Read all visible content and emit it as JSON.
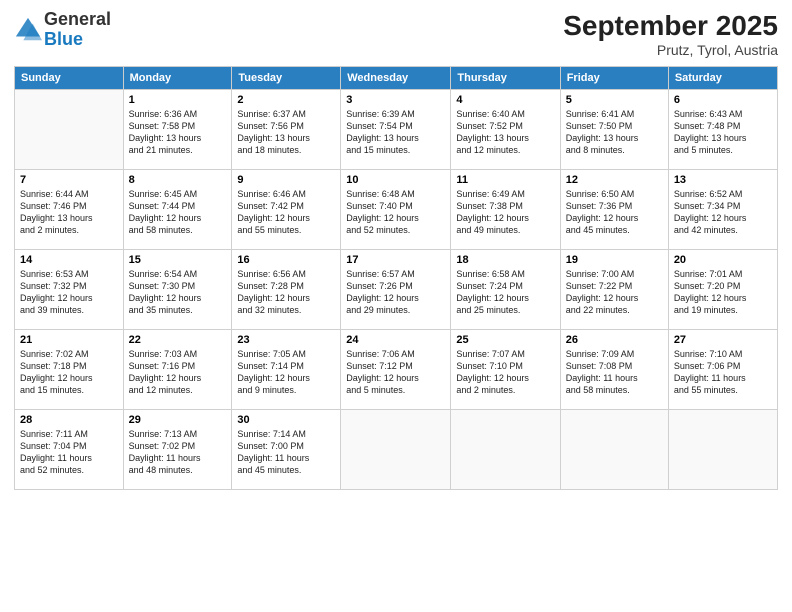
{
  "header": {
    "logo_general": "General",
    "logo_blue": "Blue",
    "month_title": "September 2025",
    "location": "Prutz, Tyrol, Austria"
  },
  "days_of_week": [
    "Sunday",
    "Monday",
    "Tuesday",
    "Wednesday",
    "Thursday",
    "Friday",
    "Saturday"
  ],
  "weeks": [
    [
      {
        "day": "",
        "text": ""
      },
      {
        "day": "1",
        "text": "Sunrise: 6:36 AM\nSunset: 7:58 PM\nDaylight: 13 hours\nand 21 minutes."
      },
      {
        "day": "2",
        "text": "Sunrise: 6:37 AM\nSunset: 7:56 PM\nDaylight: 13 hours\nand 18 minutes."
      },
      {
        "day": "3",
        "text": "Sunrise: 6:39 AM\nSunset: 7:54 PM\nDaylight: 13 hours\nand 15 minutes."
      },
      {
        "day": "4",
        "text": "Sunrise: 6:40 AM\nSunset: 7:52 PM\nDaylight: 13 hours\nand 12 minutes."
      },
      {
        "day": "5",
        "text": "Sunrise: 6:41 AM\nSunset: 7:50 PM\nDaylight: 13 hours\nand 8 minutes."
      },
      {
        "day": "6",
        "text": "Sunrise: 6:43 AM\nSunset: 7:48 PM\nDaylight: 13 hours\nand 5 minutes."
      }
    ],
    [
      {
        "day": "7",
        "text": "Sunrise: 6:44 AM\nSunset: 7:46 PM\nDaylight: 13 hours\nand 2 minutes."
      },
      {
        "day": "8",
        "text": "Sunrise: 6:45 AM\nSunset: 7:44 PM\nDaylight: 12 hours\nand 58 minutes."
      },
      {
        "day": "9",
        "text": "Sunrise: 6:46 AM\nSunset: 7:42 PM\nDaylight: 12 hours\nand 55 minutes."
      },
      {
        "day": "10",
        "text": "Sunrise: 6:48 AM\nSunset: 7:40 PM\nDaylight: 12 hours\nand 52 minutes."
      },
      {
        "day": "11",
        "text": "Sunrise: 6:49 AM\nSunset: 7:38 PM\nDaylight: 12 hours\nand 49 minutes."
      },
      {
        "day": "12",
        "text": "Sunrise: 6:50 AM\nSunset: 7:36 PM\nDaylight: 12 hours\nand 45 minutes."
      },
      {
        "day": "13",
        "text": "Sunrise: 6:52 AM\nSunset: 7:34 PM\nDaylight: 12 hours\nand 42 minutes."
      }
    ],
    [
      {
        "day": "14",
        "text": "Sunrise: 6:53 AM\nSunset: 7:32 PM\nDaylight: 12 hours\nand 39 minutes."
      },
      {
        "day": "15",
        "text": "Sunrise: 6:54 AM\nSunset: 7:30 PM\nDaylight: 12 hours\nand 35 minutes."
      },
      {
        "day": "16",
        "text": "Sunrise: 6:56 AM\nSunset: 7:28 PM\nDaylight: 12 hours\nand 32 minutes."
      },
      {
        "day": "17",
        "text": "Sunrise: 6:57 AM\nSunset: 7:26 PM\nDaylight: 12 hours\nand 29 minutes."
      },
      {
        "day": "18",
        "text": "Sunrise: 6:58 AM\nSunset: 7:24 PM\nDaylight: 12 hours\nand 25 minutes."
      },
      {
        "day": "19",
        "text": "Sunrise: 7:00 AM\nSunset: 7:22 PM\nDaylight: 12 hours\nand 22 minutes."
      },
      {
        "day": "20",
        "text": "Sunrise: 7:01 AM\nSunset: 7:20 PM\nDaylight: 12 hours\nand 19 minutes."
      }
    ],
    [
      {
        "day": "21",
        "text": "Sunrise: 7:02 AM\nSunset: 7:18 PM\nDaylight: 12 hours\nand 15 minutes."
      },
      {
        "day": "22",
        "text": "Sunrise: 7:03 AM\nSunset: 7:16 PM\nDaylight: 12 hours\nand 12 minutes."
      },
      {
        "day": "23",
        "text": "Sunrise: 7:05 AM\nSunset: 7:14 PM\nDaylight: 12 hours\nand 9 minutes."
      },
      {
        "day": "24",
        "text": "Sunrise: 7:06 AM\nSunset: 7:12 PM\nDaylight: 12 hours\nand 5 minutes."
      },
      {
        "day": "25",
        "text": "Sunrise: 7:07 AM\nSunset: 7:10 PM\nDaylight: 12 hours\nand 2 minutes."
      },
      {
        "day": "26",
        "text": "Sunrise: 7:09 AM\nSunset: 7:08 PM\nDaylight: 11 hours\nand 58 minutes."
      },
      {
        "day": "27",
        "text": "Sunrise: 7:10 AM\nSunset: 7:06 PM\nDaylight: 11 hours\nand 55 minutes."
      }
    ],
    [
      {
        "day": "28",
        "text": "Sunrise: 7:11 AM\nSunset: 7:04 PM\nDaylight: 11 hours\nand 52 minutes."
      },
      {
        "day": "29",
        "text": "Sunrise: 7:13 AM\nSunset: 7:02 PM\nDaylight: 11 hours\nand 48 minutes."
      },
      {
        "day": "30",
        "text": "Sunrise: 7:14 AM\nSunset: 7:00 PM\nDaylight: 11 hours\nand 45 minutes."
      },
      {
        "day": "",
        "text": ""
      },
      {
        "day": "",
        "text": ""
      },
      {
        "day": "",
        "text": ""
      },
      {
        "day": "",
        "text": ""
      }
    ]
  ]
}
